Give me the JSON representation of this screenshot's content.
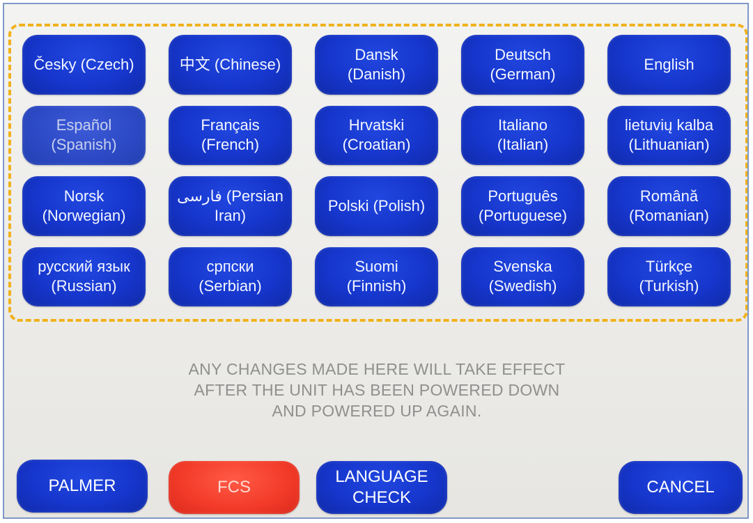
{
  "languages": [
    {
      "label": "Česky (Czech)",
      "faded": false
    },
    {
      "label": "中文 (Chinese)",
      "faded": false
    },
    {
      "label": "Dansk\n(Danish)",
      "faded": false
    },
    {
      "label": "Deutsch\n(German)",
      "faded": false
    },
    {
      "label": "English",
      "faded": false
    },
    {
      "label": "Español\n(Spanish)",
      "faded": true
    },
    {
      "label": "Français\n(French)",
      "faded": false
    },
    {
      "label": "Hrvatski\n(Croatian)",
      "faded": false
    },
    {
      "label": "Italiano\n(Italian)",
      "faded": false
    },
    {
      "label": "lietuvių kalba\n(Lithuanian)",
      "faded": false
    },
    {
      "label": "Norsk\n(Norwegian)",
      "faded": false
    },
    {
      "label": "فارسی (Persian\nIran)",
      "faded": false
    },
    {
      "label": "Polski (Polish)",
      "faded": false
    },
    {
      "label": "Português\n(Portuguese)",
      "faded": false
    },
    {
      "label": "Română\n(Romanian)",
      "faded": false
    },
    {
      "label": "русский язык\n(Russian)",
      "faded": false
    },
    {
      "label": "српски\n(Serbian)",
      "faded": false
    },
    {
      "label": "Suomi\n(Finnish)",
      "faded": false
    },
    {
      "label": "Svenska\n(Swedish)",
      "faded": false
    },
    {
      "label": "Türkçe\n(Turkish)",
      "faded": false
    }
  ],
  "notice": {
    "line1": "ANY CHANGES MADE HERE WILL TAKE EFFECT",
    "line2": "AFTER THE UNIT HAS BEEN POWERED DOWN",
    "line3": "AND POWERED UP AGAIN."
  },
  "buttons": {
    "palmer": "PALMER",
    "fcs": "FCS",
    "language_check": "LANGUAGE\nCHECK",
    "cancel": "CANCEL"
  },
  "colors": {
    "button_blue": "#1636cc",
    "button_red": "#f23a28",
    "highlight_dash": "#f0b21b",
    "notice_text": "#8f8f8f"
  }
}
